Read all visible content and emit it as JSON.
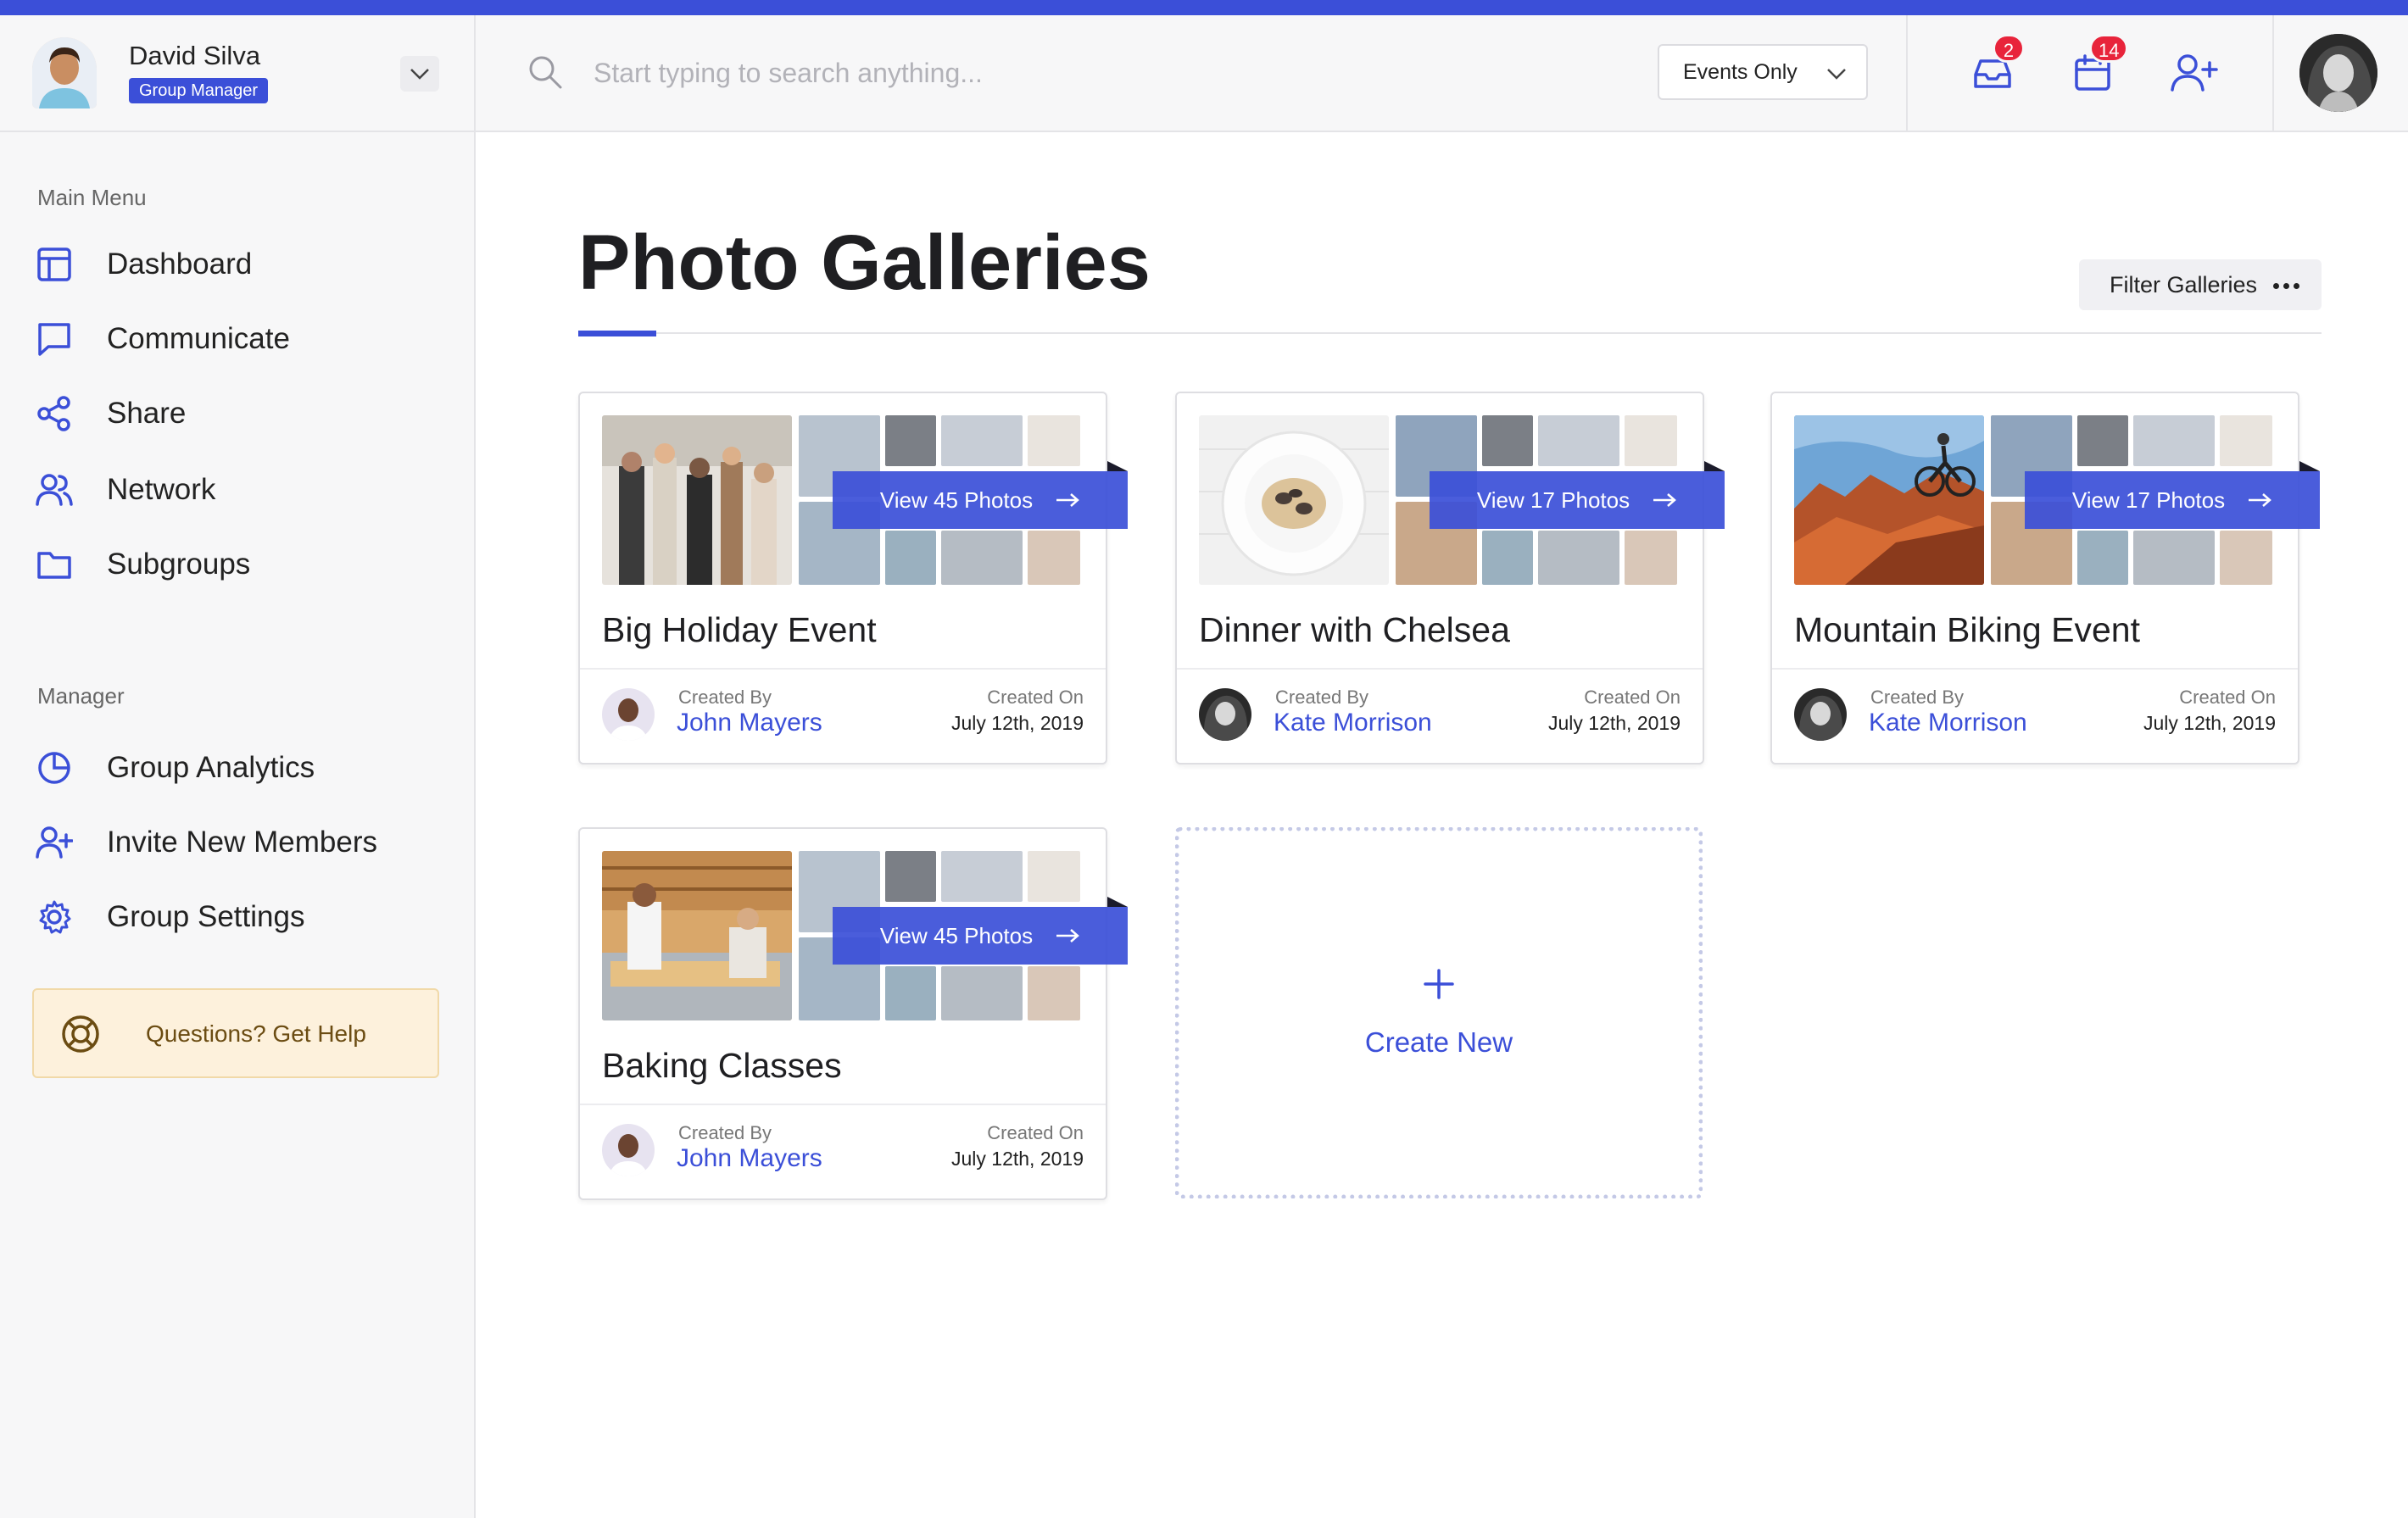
{
  "user": {
    "name": "David Silva",
    "role": "Group Manager"
  },
  "search": {
    "placeholder": "Start typing to search anything..."
  },
  "scope_select": {
    "value": "Events Only"
  },
  "header_icons": {
    "inbox_count": "2",
    "calendar_count": "14"
  },
  "sidebar": {
    "main_menu_label": "Main Menu",
    "main_items": [
      {
        "label": "Dashboard",
        "icon": "layout-icon"
      },
      {
        "label": "Communicate",
        "icon": "chat-icon"
      },
      {
        "label": "Share",
        "icon": "share-icon"
      },
      {
        "label": "Network",
        "icon": "users-icon"
      },
      {
        "label": "Subgroups",
        "icon": "folder-icon"
      }
    ],
    "manager_label": "Manager",
    "manager_items": [
      {
        "label": "Group Analytics",
        "icon": "pie-chart-icon"
      },
      {
        "label": "Invite New Members",
        "icon": "user-plus-icon"
      },
      {
        "label": "Group Settings",
        "icon": "gear-icon"
      }
    ],
    "help_label": "Questions? Get Help"
  },
  "page": {
    "title": "Photo Galleries",
    "filter_label": "Filter Galleries"
  },
  "galleries": [
    {
      "title": "Big Holiday Event",
      "view_label": "View 45 Photos",
      "created_by_label": "Created By",
      "creator": "John Mayers",
      "created_on_label": "Created On",
      "created_on": "July 12th, 2019"
    },
    {
      "title": "Dinner with Chelsea",
      "view_label": "View 17 Photos",
      "created_by_label": "Created By",
      "creator": "Kate Morrison",
      "created_on_label": "Created On",
      "created_on": "July 12th, 2019"
    },
    {
      "title": "Mountain Biking Event",
      "view_label": "View 17 Photos",
      "created_by_label": "Created By",
      "creator": "Kate Morrison",
      "created_on_label": "Created On",
      "created_on": "July 12th, 2019"
    },
    {
      "title": "Baking Classes",
      "view_label": "View 45 Photos",
      "created_by_label": "Created By",
      "creator": "John Mayers",
      "created_on_label": "Created On",
      "created_on": "July 12th, 2019"
    }
  ],
  "create_new": {
    "label": "Create New"
  },
  "colors": {
    "accent": "#3b4fd8",
    "badge": "#e8243b",
    "help_bg": "#fdf1dc"
  }
}
